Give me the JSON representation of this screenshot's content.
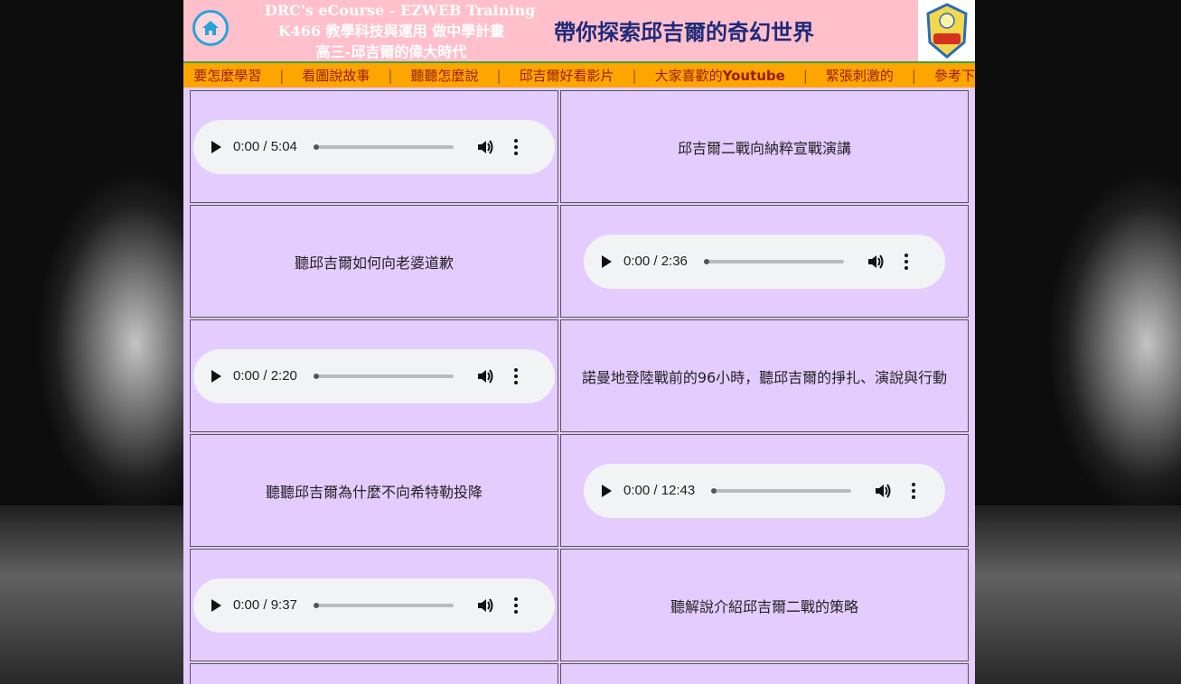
{
  "header": {
    "course_line1": "DRC's eCourse - EZWEB Training",
    "course_line2": "K466 教學科技與運用 做中學計畫",
    "course_line3": "高三-邱吉爾的偉大時代",
    "slogan": "帶你探索邱吉爾的奇幻世界",
    "home_icon": "home-icon",
    "logo": "school-logo"
  },
  "nav": {
    "items": [
      "要怎麼學習",
      "看圖說故事",
      "聽聽怎麼說",
      "邱吉爾好看影片",
      "大家喜歡的",
      "緊張刺激的",
      "參考下"
    ],
    "youtube_word": "Youtube",
    "separator": "|"
  },
  "audio": {
    "player_icon_play": "play-icon",
    "player_icon_volume": "volume-icon",
    "player_icon_menu": "more-vert-icon"
  },
  "rows": [
    {
      "audio_time": "0:00 / 5:04",
      "label": "邱吉爾二戰向納粹宣戰演講",
      "audio_side": "left"
    },
    {
      "audio_time": "0:00 / 2:36",
      "label": "聽邱吉爾如何向老婆道歉",
      "audio_side": "right"
    },
    {
      "audio_time": "0:00 / 2:20",
      "label": "諾曼地登陸戰前的96小時，聽邱吉爾的掙扎、演說與行動",
      "audio_side": "left"
    },
    {
      "audio_time": "0:00 / 12:43",
      "label": "聽聽邱吉爾為什麼不向希特勒投降",
      "audio_side": "right"
    },
    {
      "audio_time": "0:00 / 9:37",
      "label": "聽解說介紹邱吉爾二戰的策略",
      "audio_side": "left"
    }
  ],
  "colors": {
    "banner_bg": "#ffc0cb",
    "nav_bg": "#ffa500",
    "nav_text": "#9b1c00",
    "content_bg": "#e4ccff",
    "slogan": "#1e2a7a"
  }
}
